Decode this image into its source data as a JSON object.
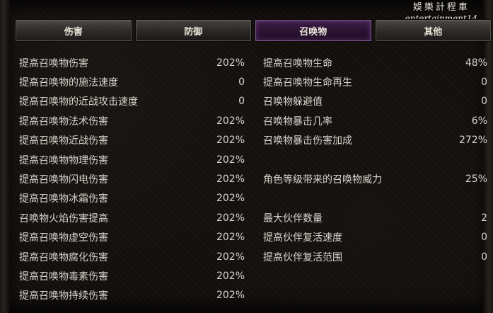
{
  "tabs": [
    {
      "label": "伤害"
    },
    {
      "label": "防御"
    },
    {
      "label": "召唤物"
    },
    {
      "label": "其他"
    }
  ],
  "watermark": {
    "chinese": "娛樂計程車",
    "english": "entertainment14"
  },
  "left_stats": [
    {
      "label": "提高召唤物伤害",
      "value": "202%"
    },
    {
      "label": "提高召唤物的施法速度",
      "value": "0"
    },
    {
      "label": "提高召唤物的近战攻击速度",
      "value": "0"
    },
    {
      "label": "提高召唤物法术伤害",
      "value": "202%"
    },
    {
      "label": "提高召唤物近战伤害",
      "value": "202%"
    },
    {
      "label": "提高召唤物物理伤害",
      "value": "202%"
    },
    {
      "label": "提高召唤物闪电伤害",
      "value": "202%"
    },
    {
      "label": "提高召唤物冰霜伤害",
      "value": "202%"
    },
    {
      "label": "召唤物火焰伤害提高",
      "value": "202%"
    },
    {
      "label": "提高召唤物虚空伤害",
      "value": "202%"
    },
    {
      "label": "提高召唤物腐化伤害",
      "value": "202%"
    },
    {
      "label": "提高召唤物毒素伤害",
      "value": "202%"
    },
    {
      "label": "提高召唤物持续伤害",
      "value": "202%"
    }
  ],
  "right_stats": [
    {
      "label": "提高召唤物生命",
      "value": "48%"
    },
    {
      "label": "提高召唤物生命再生",
      "value": "0"
    },
    {
      "label": "召唤物躲避值",
      "value": "0"
    },
    {
      "label": "召唤物暴击几率",
      "value": "6%"
    },
    {
      "label": "召唤物暴击伤害加成",
      "value": "272%"
    },
    {
      "label": "角色等级带来的召唤物威力",
      "value": "25%"
    },
    {
      "label": "最大伙伴数量",
      "value": "2"
    },
    {
      "label": "提高伙伴复活速度",
      "value": "0"
    },
    {
      "label": "提高伙伴复活范围",
      "value": "0"
    }
  ]
}
